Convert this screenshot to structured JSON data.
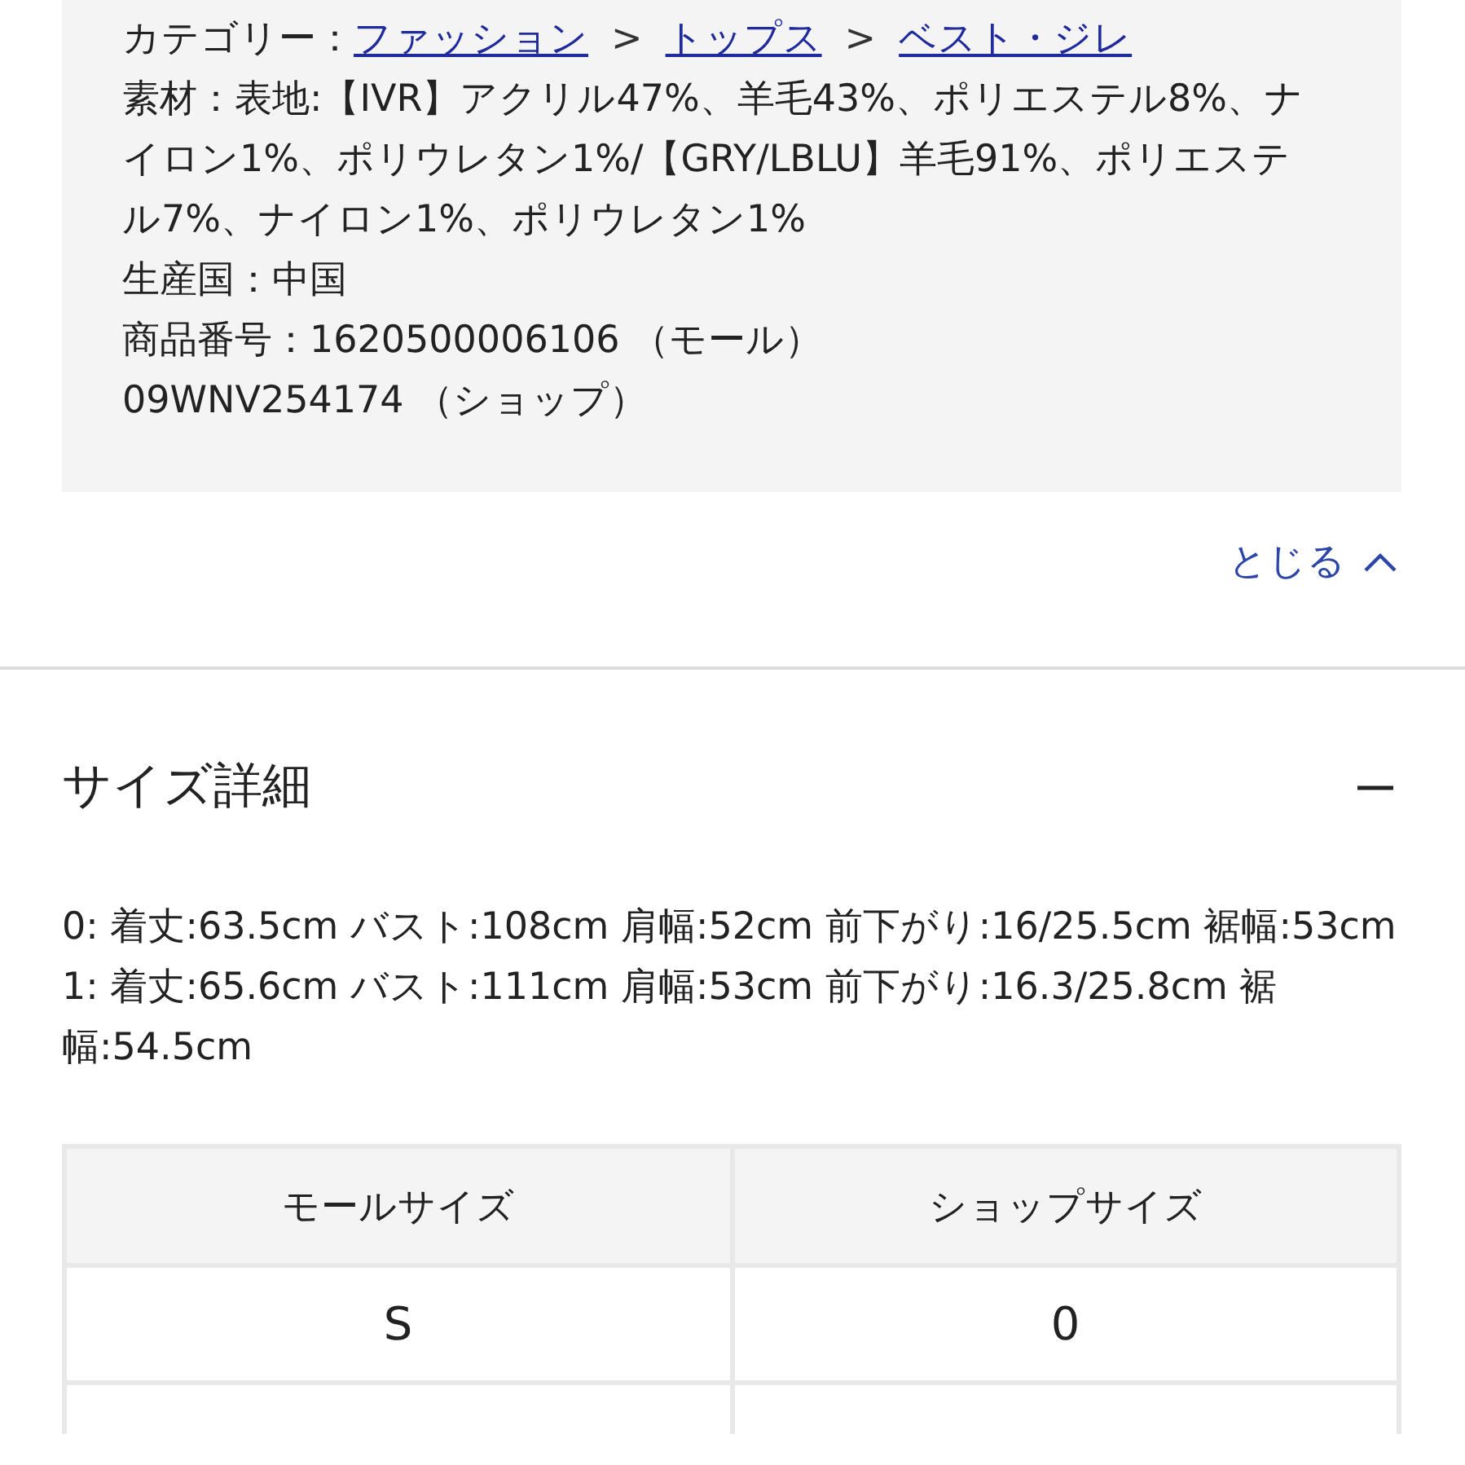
{
  "product_info": {
    "category_label": "カテゴリー：",
    "category_path": [
      "ファッション",
      "トップス",
      "ベスト・ジレ"
    ],
    "separators": [
      ">",
      ">"
    ],
    "details": [
      "素材：表地:【IVR】アクリル47%、羊毛43%、ポリエステル8%、ナイロン1%、ポリウレタン1%/【GRY/LBLU】羊毛91%、ポリエステル7%、ナイロン1%、ポリウレタン1%",
      "生産国：中国",
      "商品番号：1620500006106 （モール）",
      "09WNV254174 （ショップ）"
    ]
  },
  "close_link": {
    "label": "とじる"
  },
  "size_section": {
    "title": "サイズ詳細",
    "expanded": true,
    "details": [
      "0: 着丈:63.5cm バスト:108cm 肩幅:52cm 前下がり:16/25.5cm 裾幅:53cm",
      "1: 着丈:65.6cm バスト:111cm 肩幅:53cm 前下がり:16.3/25.8cm 裾幅:54.5cm"
    ],
    "table": {
      "columns": [
        "モールサイズ",
        "ショップサイズ"
      ],
      "rows": [
        [
          "S",
          "0"
        ]
      ]
    }
  }
}
